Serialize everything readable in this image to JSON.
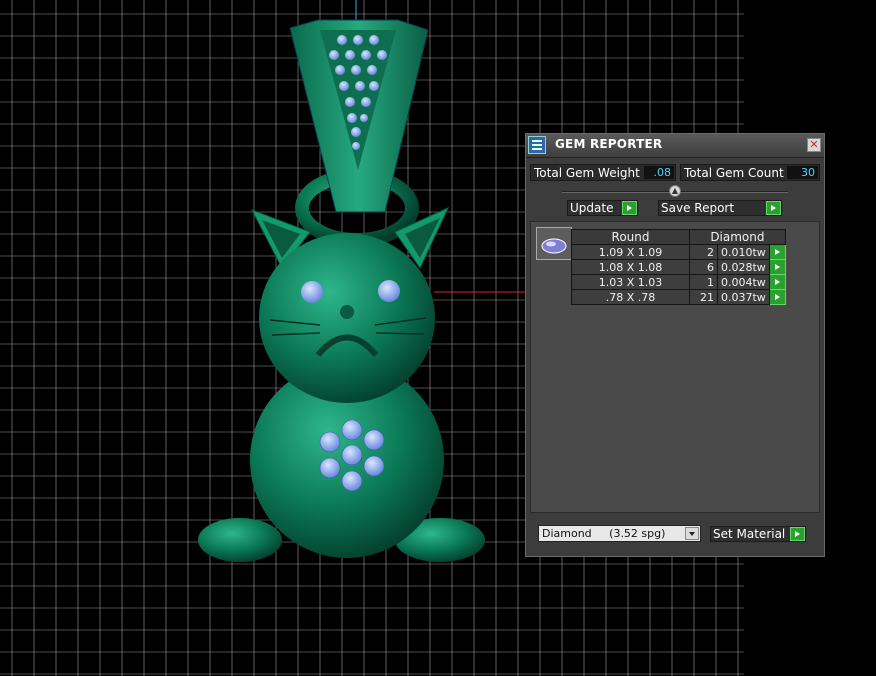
{
  "panel": {
    "title": "GEM REPORTER",
    "close_label": "✕",
    "total_gem_weight_label": "Total Gem Weight",
    "total_gem_weight_value": ".08",
    "total_gem_count_label": "Total Gem Count",
    "total_gem_count_value": "30",
    "update_label": "Update",
    "save_report_label": "Save Report",
    "table": {
      "shape_header": "Round",
      "material_header": "Diamond",
      "rows": [
        {
          "size": "1.09 X 1.09",
          "count": "2",
          "weight": "0.010tw"
        },
        {
          "size": "1.08 X 1.08",
          "count": "6",
          "weight": "0.028tw"
        },
        {
          "size": "1.03 X 1.03",
          "count": "1",
          "weight": "0.004tw"
        },
        {
          "size": ".78 X .78",
          "count": "21",
          "weight": "0.037tw"
        }
      ]
    },
    "material_select": "Diamond     (3.52 spg)",
    "set_material_label": "Set Material"
  },
  "colors": {
    "grid": "#9a9a9a",
    "model_green": "#0d7a58",
    "gem_blue": "#8fb6ff",
    "accent_green_button": "#29a12e",
    "value_text": "#4fd4ff"
  }
}
